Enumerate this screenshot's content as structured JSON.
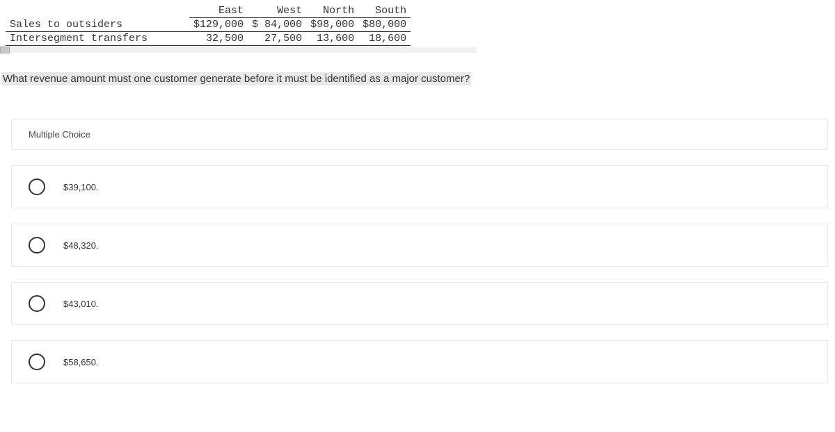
{
  "table": {
    "headers": [
      "",
      "East",
      "West",
      "North",
      "South"
    ],
    "rows": [
      {
        "label": "Sales to outsiders",
        "values": [
          "$129,000",
          "$ 84,000",
          "$98,000",
          "$80,000"
        ]
      },
      {
        "label": "Intersegment transfers",
        "values": [
          "32,500",
          "27,500",
          "13,600",
          "18,600"
        ]
      }
    ]
  },
  "question": "What revenue amount must one customer generate before it must be identified as a major customer?",
  "mc_label": "Multiple Choice",
  "options": [
    "$39,100.",
    "$48,320.",
    "$43,010.",
    "$58,650."
  ]
}
